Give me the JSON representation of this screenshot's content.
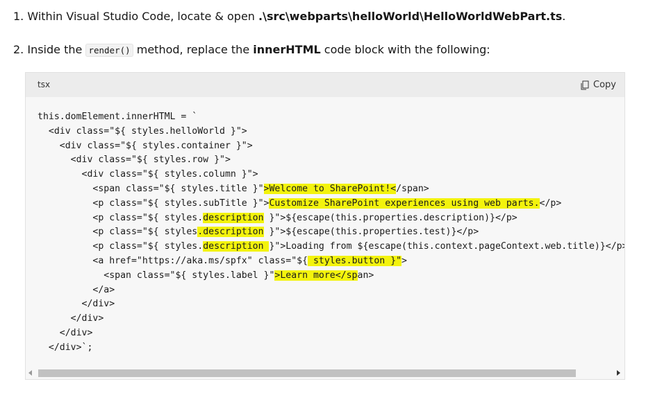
{
  "steps": [
    {
      "number": "1.",
      "text_before": "Within Visual Studio Code, locate & open ",
      "path": ".\\src\\webparts\\helloWorld\\HelloWorldWebPart.ts",
      "text_after": "."
    },
    {
      "number": "2.",
      "text_before": "Inside the ",
      "inline_code": "render()",
      "text_middle": " method, replace the ",
      "bold": "innerHTML",
      "text_after": " code block with the following:"
    }
  ],
  "code_block": {
    "language": "tsx",
    "copy_label": "Copy",
    "lines": [
      [
        {
          "t": "this.domElement.innerHTML = `"
        }
      ],
      [
        {
          "t": "  <div class=\"${ styles.helloWorld }\">"
        }
      ],
      [
        {
          "t": "    <div class=\"${ styles.container }\">"
        }
      ],
      [
        {
          "t": "      <div class=\"${ styles.row }\">"
        }
      ],
      [
        {
          "t": "        <div class=\"${ styles.column }\">"
        }
      ],
      [
        {
          "t": "          <span class=\"${ styles.title }\""
        },
        {
          "t": ">Welcome to SharePoint!<",
          "hl": true
        },
        {
          "t": "/span>"
        }
      ],
      [
        {
          "t": "          <p class=\"${ styles.subTitle }\">"
        },
        {
          "t": "Customize SharePoint experiences using web parts.",
          "hl": true
        },
        {
          "t": "</p>"
        }
      ],
      [
        {
          "t": "          <p class=\"${ styles."
        },
        {
          "t": "description",
          "hl": true
        },
        {
          "t": " }\">${escape(this.properties.description)}</p>"
        }
      ],
      [
        {
          "t": "          <p class=\"${ styles"
        },
        {
          "t": ".description",
          "hl": true
        },
        {
          "t": " }\">${escape(this.properties.test)}</p>"
        }
      ],
      [
        {
          "t": "          <p class=\"${ styles."
        },
        {
          "t": "description ",
          "hl": true
        },
        {
          "t": "}\">Loading from ${escape(this.context.pageContext.web.title)}</p>"
        }
      ],
      [
        {
          "t": "          <a href=\"https://aka.ms/spfx\" class=\"${"
        },
        {
          "t": " styles.button }\"",
          "hl": true
        },
        {
          "t": ">"
        }
      ],
      [
        {
          "t": "            <span class=\"${ styles.label }\""
        },
        {
          "t": ">Learn more</sp",
          "hl": true
        },
        {
          "t": "an>"
        }
      ],
      [
        {
          "t": "          </a>"
        }
      ],
      [
        {
          "t": "        </div>"
        }
      ],
      [
        {
          "t": "      </div>"
        }
      ],
      [
        {
          "t": "    </div>"
        }
      ],
      [
        {
          "t": "  </div>`;"
        }
      ]
    ]
  },
  "colors": {
    "highlight": "#f3f30d",
    "code_background": "#f7f7f7",
    "header_background": "#ececec"
  }
}
